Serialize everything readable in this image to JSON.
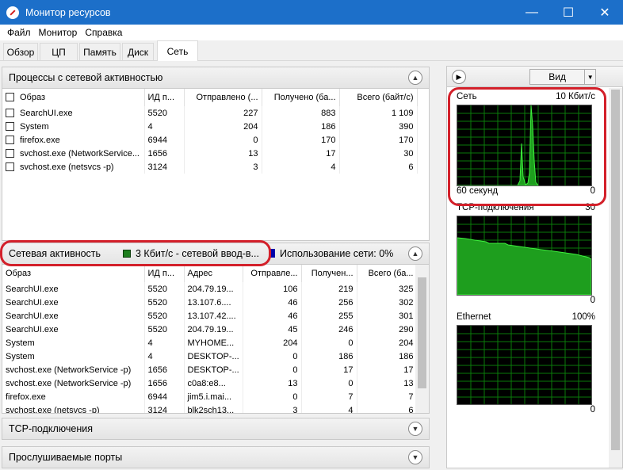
{
  "window": {
    "title": "Монитор ресурсов",
    "minimize": "—",
    "maximize": "☐",
    "close": "✕"
  },
  "menu": [
    "Файл",
    "Монитор",
    "Справка"
  ],
  "tabs": [
    "Обзор",
    "ЦП",
    "Память",
    "Диск",
    "Сеть"
  ],
  "active_tab": "Сеть",
  "processes_panel": {
    "title": "Процессы с сетевой активностью",
    "columns": [
      "Образ",
      "ИД п...",
      "Отправлено (...",
      "Получено (ба...",
      "Всего (байт/с)"
    ],
    "rows": [
      [
        "SearchUI.exe",
        "5520",
        "227",
        "883",
        "1 109"
      ],
      [
        "System",
        "4",
        "204",
        "186",
        "390"
      ],
      [
        "firefox.exe",
        "6944",
        "0",
        "170",
        "170"
      ],
      [
        "svchost.exe (NetworkService...",
        "1656",
        "13",
        "17",
        "30"
      ],
      [
        "svchost.exe (netsvcs -p)",
        "3124",
        "3",
        "4",
        "6"
      ]
    ]
  },
  "network_panel": {
    "title": "Сетевая активность",
    "io_label": "3 Кбит/с - сетевой ввод-в...",
    "usage_label": "Использование сети: 0%",
    "columns": [
      "Образ",
      "ИД п...",
      "Адрес",
      "Отправле...",
      "Получен...",
      "Всего (ба..."
    ],
    "rows": [
      [
        "SearchUI.exe",
        "5520",
        "204.79.19...",
        "106",
        "219",
        "325"
      ],
      [
        "SearchUI.exe",
        "5520",
        "13.107.6....",
        "46",
        "256",
        "302"
      ],
      [
        "SearchUI.exe",
        "5520",
        "13.107.42....",
        "46",
        "255",
        "301"
      ],
      [
        "SearchUI.exe",
        "5520",
        "204.79.19...",
        "45",
        "246",
        "290"
      ],
      [
        "System",
        "4",
        "MYHOME...",
        "204",
        "0",
        "204"
      ],
      [
        "System",
        "4",
        "DESKTOP-...",
        "0",
        "186",
        "186"
      ],
      [
        "svchost.exe (NetworkService -p)",
        "1656",
        "DESKTOP-...",
        "0",
        "17",
        "17"
      ],
      [
        "svchost.exe (NetworkService -p)",
        "1656",
        "c0a8:e8...",
        "13",
        "0",
        "13"
      ],
      [
        "firefox.exe",
        "6944",
        "jim5.i.mai...",
        "0",
        "7",
        "7"
      ],
      [
        "svchost.exe (netsvcs -p)",
        "3124",
        "blk2sch13...",
        "3",
        "4",
        "6"
      ]
    ]
  },
  "tcp_panel": {
    "title": "TCP-подключения"
  },
  "ports_panel": {
    "title": "Прослушиваемые порты"
  },
  "right_pane": {
    "view_label": "Вид",
    "graphs": [
      {
        "name": "Сеть",
        "scale": "10 Кбит/с",
        "foot_left": "60 секунд",
        "foot_right": "0"
      },
      {
        "name": "TCP-подключения",
        "scale": "30",
        "foot_left": "",
        "foot_right": "0"
      },
      {
        "name": "Ethernet",
        "scale": "100%",
        "foot_left": "",
        "foot_right": "0"
      }
    ]
  },
  "colors": {
    "titlebar": "#1c6fc9",
    "graph_line": "#19e019",
    "graph_grid": "#0a7a0a",
    "highlight": "#d3202a"
  }
}
